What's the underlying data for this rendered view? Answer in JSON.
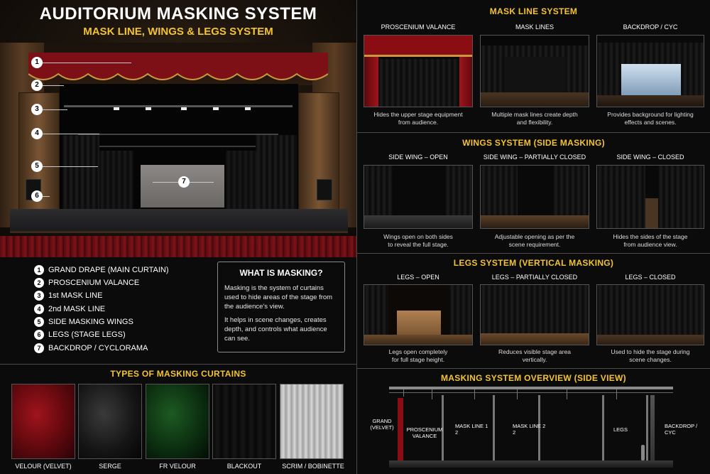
{
  "header": {
    "title": "AUDITORIUM MASKING SYSTEM",
    "subtitle": "MASK LINE, WINGS & LEGS SYSTEM"
  },
  "hero": {
    "markers": [
      "1",
      "2",
      "3",
      "4",
      "5",
      "6",
      "7"
    ]
  },
  "legend": [
    {
      "num": "1",
      "label": "GRAND DRAPE (MAIN CURTAIN)"
    },
    {
      "num": "2",
      "label": "PROSCENIUM VALANCE"
    },
    {
      "num": "3",
      "label": "1st MASK LINE"
    },
    {
      "num": "4",
      "label": "2nd MASK LINE"
    },
    {
      "num": "5",
      "label": "SIDE MASKING WINGS"
    },
    {
      "num": "6",
      "label": "LEGS (STAGE LEGS)"
    },
    {
      "num": "7",
      "label": "BACKDROP / CYCLORAMA"
    }
  ],
  "info": {
    "heading": "WHAT IS MASKING?",
    "p1": "Masking is the system of curtains used to hide areas of the stage from the audience's view.",
    "p2": "It helps in scene changes, creates depth, and controls what audience can see."
  },
  "types": {
    "heading": "TYPES OF MASKING CURTAINS",
    "items": [
      "VELOUR (VELVET)",
      "SERGE",
      "FR VELOUR",
      "BLACKOUT",
      "SCRIM / BOBINETTE"
    ]
  },
  "mask_line": {
    "heading": "MASK LINE SYSTEM",
    "items": [
      {
        "label": "PROSCENIUM VALANCE",
        "caption1": "Hides the upper stage equipment",
        "caption2": "from audience."
      },
      {
        "label": "MASK LINES",
        "caption1": "Multiple mask lines create depth",
        "caption2": "and flexibility."
      },
      {
        "label": "BACKDROP / CYC",
        "caption1": "Provides background for lighting",
        "caption2": "effects and scenes."
      }
    ]
  },
  "wings": {
    "heading": "WINGS SYSTEM (SIDE MASKING)",
    "items": [
      {
        "label": "SIDE WING – OPEN",
        "caption1": "Wings open on both sides",
        "caption2": "to reveal the full stage."
      },
      {
        "label": "SIDE WING – PARTIALLY CLOSED",
        "caption1": "Adjustable opening as per the",
        "caption2": "scene requirement."
      },
      {
        "label": "SIDE WING – CLOSED",
        "caption1": "Hides the sides of the stage",
        "caption2": "from audience view."
      }
    ]
  },
  "legs": {
    "heading": "LEGS SYSTEM (VERTICAL MASKING)",
    "items": [
      {
        "label": "LEGS – OPEN",
        "caption1": "Legs open completely",
        "caption2": "for full stage height."
      },
      {
        "label": "LEGS – PARTIALLY CLOSED",
        "caption1": "Reduces visible stage area",
        "caption2": "vertically."
      },
      {
        "label": "LEGS – CLOSED",
        "caption1": "Used to hide the stage during",
        "caption2": "scene changes."
      }
    ]
  },
  "side_view": {
    "heading": "MASKING SYSTEM OVERVIEW (SIDE VIEW)",
    "grand_1": "GRAND",
    "grand_2": "(VELVET)",
    "valance_1": "PROSCENIUM",
    "valance_2": "VALANCE",
    "ml1_1": "MASK LINE 1",
    "ml1_2": "2",
    "ml2_1": "MASK LINE 2",
    "ml2_2": "2",
    "legs": "LEGS",
    "cyc_1": "BACKDROP /",
    "cyc_2": "CYC"
  },
  "colors": {
    "accent": "#f4c430",
    "velvet": "#8b0d14",
    "background": "#0b0b0b"
  }
}
